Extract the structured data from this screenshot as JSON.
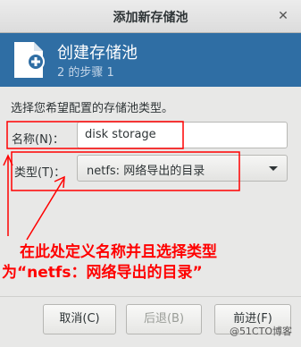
{
  "window": {
    "title": "添加新存储池",
    "close_icon": "close-icon"
  },
  "banner": {
    "title": "创建存储池",
    "step": "2 的步骤 1",
    "icon": "storage-pool-add-icon",
    "color": "#2f6ea4"
  },
  "form": {
    "instruction": "选择您希望配置的存储池类型。",
    "name_label": "名称(N)：",
    "name_value": "disk storage",
    "type_label": "类型(T)：",
    "type_value": "netfs: 网络导出的目录"
  },
  "annotation": {
    "line1": "在此处定义名称并且选择类型",
    "line2": "为“netfs：网络导出的目录”",
    "color": "#ff0000"
  },
  "buttons": {
    "cancel": "取消(C)",
    "back": "后退(B)",
    "forward": "前进(F)"
  },
  "watermark": "@51CTO博客"
}
